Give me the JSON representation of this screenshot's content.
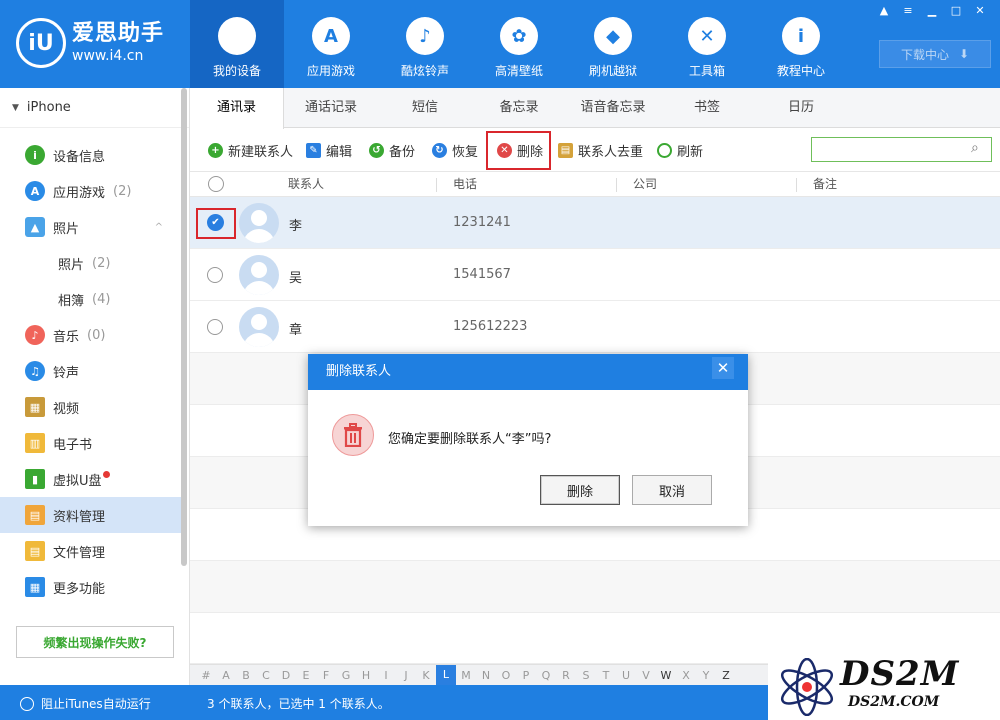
{
  "app": {
    "name": "爱思助手",
    "url": "www.i4.cn",
    "logo_mark": "iU"
  },
  "topnav": [
    {
      "label": "我的设备",
      "icon": "apple-icon",
      "active": true
    },
    {
      "label": "应用游戏",
      "icon": "app-store-icon"
    },
    {
      "label": "酷炫铃声",
      "icon": "bell-icon"
    },
    {
      "label": "高清壁纸",
      "icon": "flower-icon"
    },
    {
      "label": "刷机越狱",
      "icon": "dropbox-icon"
    },
    {
      "label": "工具箱",
      "icon": "tools-icon"
    },
    {
      "label": "教程中心",
      "icon": "info-icon"
    }
  ],
  "download_label": "下载中心",
  "sidebar": {
    "device": "iPhone",
    "items": [
      {
        "label": "设备信息",
        "icon": "info-icon",
        "color": "#3aa832"
      },
      {
        "label": "应用游戏",
        "count": "(2)",
        "icon": "app-store-icon",
        "color": "#2a8be6"
      },
      {
        "label": "照片",
        "icon": "photo-icon",
        "color": "#4aa3e8"
      },
      {
        "label": "照片",
        "count": "(2)"
      },
      {
        "label": "相簿",
        "count": "(4)"
      },
      {
        "label": "音乐",
        "count": "(0)",
        "icon": "music-icon",
        "color": "#f0645a"
      },
      {
        "label": "铃声",
        "icon": "bell-icon",
        "color": "#2a8be6"
      },
      {
        "label": "视频",
        "icon": "film-icon",
        "color": "#c89a3a"
      },
      {
        "label": "电子书",
        "icon": "book-icon",
        "color": "#f0b93a"
      },
      {
        "label": "虚拟U盘",
        "icon": "usb-icon",
        "color": "#3aa832"
      },
      {
        "label": "资料管理",
        "icon": "contacts-icon",
        "color": "#f0a53a"
      },
      {
        "label": "文件管理",
        "icon": "folder-icon",
        "color": "#f0b93a"
      },
      {
        "label": "更多功能",
        "icon": "grid-icon",
        "color": "#2a8be6"
      }
    ],
    "help_button": "频繁出现操作失败?"
  },
  "tabs": [
    "通讯录",
    "通话记录",
    "短信",
    "备忘录",
    "语音备忘录",
    "书签",
    "日历"
  ],
  "toolbar": {
    "new": "新建联系人",
    "edit": "编辑",
    "backup": "备份",
    "restore": "恢复",
    "delete": "删除",
    "dedupe": "联系人去重",
    "refresh": "刷新"
  },
  "columns": [
    "联系人",
    "电话",
    "公司",
    "备注"
  ],
  "contacts": [
    {
      "name": "李",
      "phone": "1231241",
      "selected": true
    },
    {
      "name": "吴",
      "phone": "1541567",
      "selected": false
    },
    {
      "name": "章",
      "phone": "125612223",
      "selected": false
    }
  ],
  "alphabet": [
    "#",
    "A",
    "B",
    "C",
    "D",
    "E",
    "F",
    "G",
    "H",
    "I",
    "J",
    "K",
    "L",
    "M",
    "N",
    "O",
    "P",
    "Q",
    "R",
    "S",
    "T",
    "U",
    "V",
    "W",
    "X",
    "Y",
    "Z"
  ],
  "alphabet_active": "L",
  "status": {
    "itunes": "阻止iTunes自动运行",
    "summary": "3 个联系人，已选中 1 个联系人。"
  },
  "dialog": {
    "title": "删除联系人",
    "message": "您确定要删除联系人“李”吗?",
    "ok": "删除",
    "cancel": "取消"
  },
  "watermark": {
    "big": "DS2M",
    "small": "DS2M.COM"
  },
  "colors": {
    "brand": "#1f7fe1",
    "selected_row": "#e5eef8",
    "highlight": "#d9262c"
  }
}
